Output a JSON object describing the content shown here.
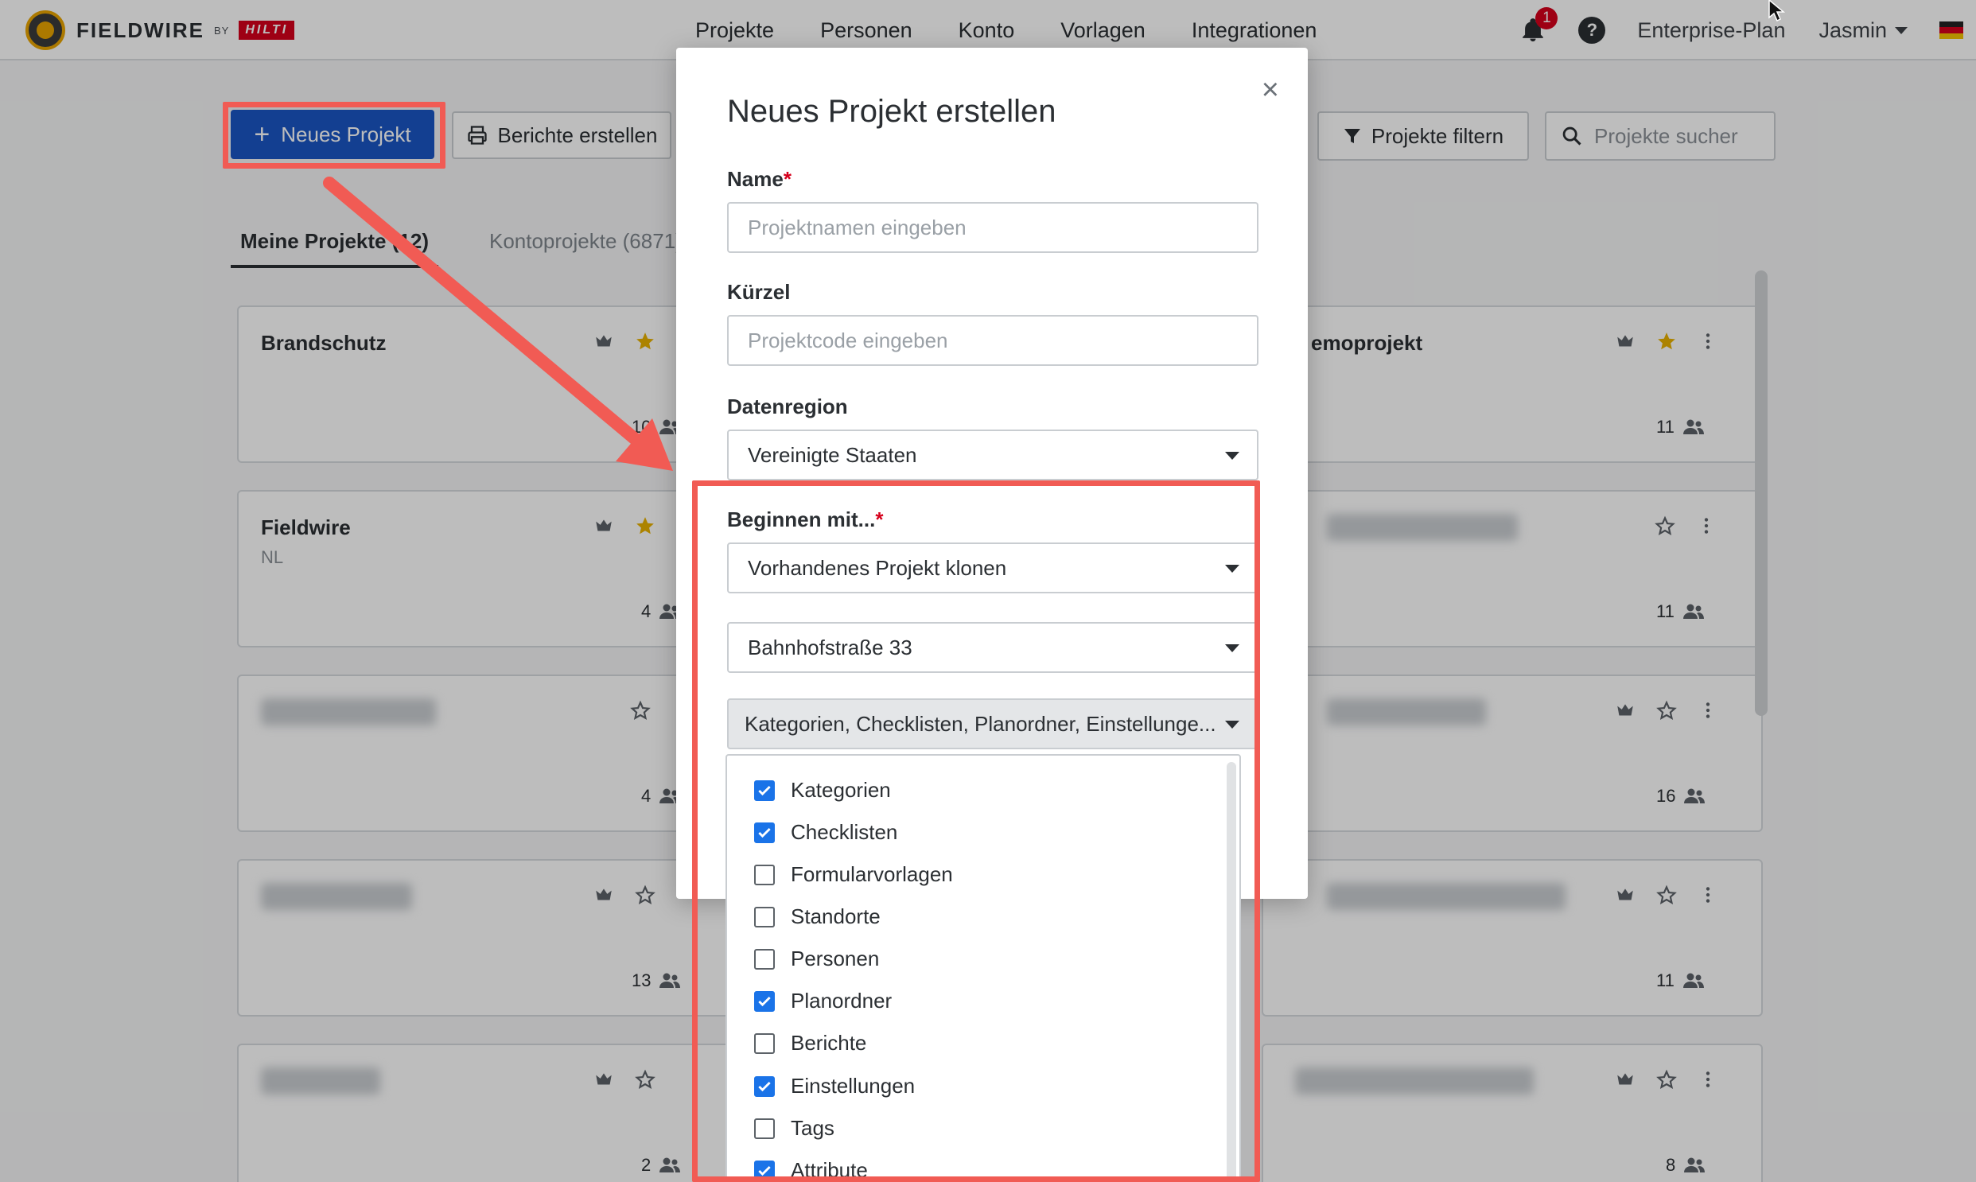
{
  "app": {
    "brand": "FIELDWIRE",
    "by": "BY",
    "brand_partner": "HILTI"
  },
  "topnav": [
    "Projekte",
    "Personen",
    "Konto",
    "Vorlagen",
    "Integrationen"
  ],
  "topright": {
    "notifications": "1",
    "help": "?",
    "plan": "Enterprise-Plan",
    "user": "Jasmin"
  },
  "toolbar": {
    "new_project": "Neues Projekt",
    "reports": "Berichte erstellen",
    "filter": "Projekte filtern",
    "search_placeholder": "Projekte sucher"
  },
  "tabs": [
    {
      "label": "Meine Projekte (12)",
      "active": true
    },
    {
      "label": "Kontoprojekte (6871)",
      "active": false
    }
  ],
  "cards_left": [
    {
      "title": "Brandschutz",
      "subtitle": "",
      "count": "10",
      "starred": true,
      "crown": true
    },
    {
      "title": "Fieldwire",
      "subtitle": "NL",
      "count": "4",
      "starred": true,
      "crown": true
    },
    {
      "title": "",
      "subtitle": "",
      "count": "4",
      "starred": false,
      "crown": false
    },
    {
      "title": "",
      "subtitle": "",
      "count": "13",
      "starred": false,
      "crown": true
    },
    {
      "title": "",
      "subtitle": "",
      "count": "2",
      "starred": false,
      "crown": true
    }
  ],
  "cards_right": [
    {
      "title": "emoprojekt",
      "count": "11",
      "starred": true
    },
    {
      "title": "",
      "count": "11",
      "starred": false
    },
    {
      "title": "",
      "count": "16",
      "starred": false
    },
    {
      "title": "",
      "count": "11",
      "starred": false
    },
    {
      "title": "",
      "count": "8",
      "starred": false
    }
  ],
  "modal": {
    "title": "Neues Projekt erstellen",
    "close": "×",
    "name_label": "Name",
    "name_placeholder": "Projektnamen eingeben",
    "code_label": "Kürzel",
    "code_placeholder": "Projektcode eingeben",
    "region_label": "Datenregion",
    "region_value": "Vereinigte Staaten",
    "start_label": "Beginnen mit...",
    "start_value": "Vorhandenes Projekt klonen",
    "source_project": "Bahnhofstraße 33",
    "clone_items_summary": "Kategorien, Checklisten, Planordner, Einstellunge...",
    "required_mark": "*",
    "options": [
      {
        "label": "Kategorien",
        "checked": true
      },
      {
        "label": "Checklisten",
        "checked": true
      },
      {
        "label": "Formularvorlagen",
        "checked": false
      },
      {
        "label": "Standorte",
        "checked": false
      },
      {
        "label": "Personen",
        "checked": false
      },
      {
        "label": "Planordner",
        "checked": true
      },
      {
        "label": "Berichte",
        "checked": false
      },
      {
        "label": "Einstellungen",
        "checked": true
      },
      {
        "label": "Tags",
        "checked": false
      },
      {
        "label": "Attribute",
        "checked": true
      }
    ]
  },
  "colors": {
    "primary": "#1a56c4",
    "checkbox": "#1a73e8",
    "annotation": "#f15b54",
    "star": "#e8b100"
  }
}
